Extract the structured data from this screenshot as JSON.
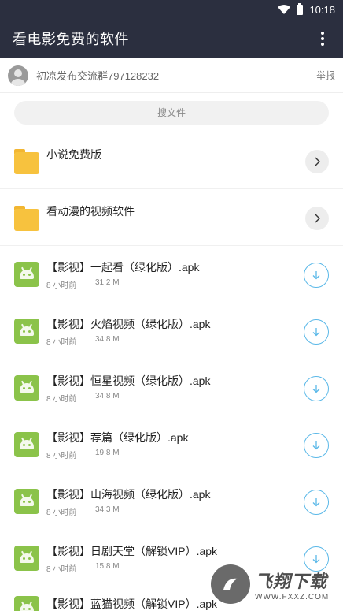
{
  "status_bar": {
    "time": "10:18"
  },
  "app_bar": {
    "title": "看电影免费的软件"
  },
  "publisher": {
    "name": "初凉发布交流群797128232",
    "report_label": "举报"
  },
  "search": {
    "placeholder": "搜文件"
  },
  "folders": [
    {
      "name": "小说免费版"
    },
    {
      "name": "看动漫的视频软件"
    }
  ],
  "files": [
    {
      "name": "【影视】一起看（绿化版）.apk",
      "time": "8 小时前",
      "size": "31.2 M"
    },
    {
      "name": "【影视】火焰视频（绿化版）.apk",
      "time": "8 小时前",
      "size": "34.8 M"
    },
    {
      "name": "【影视】恒星视频（绿化版）.apk",
      "time": "8 小时前",
      "size": "34.8 M"
    },
    {
      "name": "【影视】荐篇（绿化版）.apk",
      "time": "8 小时前",
      "size": "19.8 M"
    },
    {
      "name": "【影视】山海视频（绿化版）.apk",
      "time": "8 小时前",
      "size": "34.3 M"
    },
    {
      "name": "【影视】日剧天堂（解锁VIP）.apk",
      "time": "8 小时前",
      "size": "15.8 M"
    },
    {
      "name": "【影视】蓝猫视频（解锁VIP）.apk"
    }
  ],
  "watermark": {
    "text": "飞翔下载",
    "url": "WWW.FXXZ.COM"
  },
  "colors": {
    "header_bg": "#2b2f3f",
    "folder": "#f7c23e",
    "android": "#8bc34a",
    "download_accent": "#5ab8e8"
  }
}
